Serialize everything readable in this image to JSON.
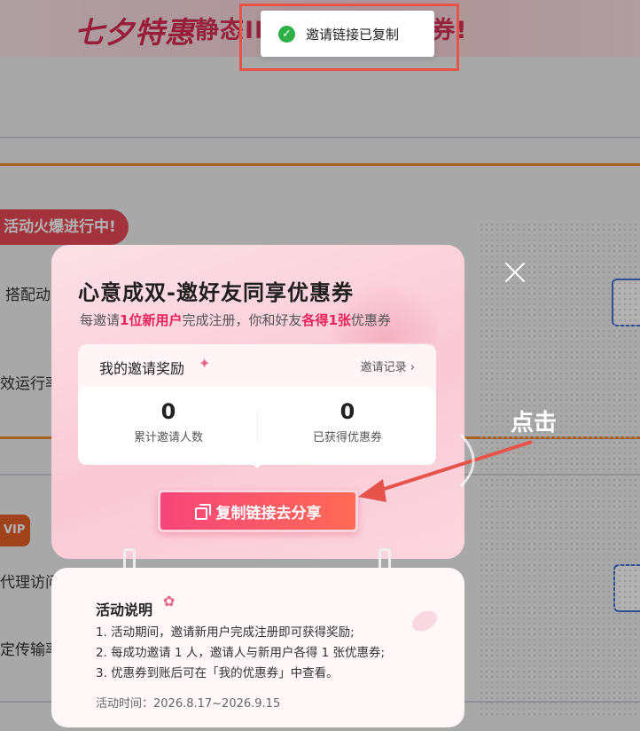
{
  "banner": {
    "logo": "七夕特惠",
    "slogan": "静态IP 好友互赠折扣券!"
  },
  "background": {
    "hot_tag": "活动火爆进行中!",
    "text_1": "搭配动",
    "text_2": "效运行率",
    "vip_tag": "VIP",
    "text_3": "代理访问",
    "text_4": "定传输率"
  },
  "toast": {
    "message": "邀请链接已复制"
  },
  "invite_card": {
    "title": "心意成双-邀好友同享优惠券",
    "subtitle_prefix": "每邀请",
    "subtitle_hl1": "1位新用户",
    "subtitle_mid": "完成注册，你和好友",
    "subtitle_hl2": "各得1张",
    "subtitle_suffix": "优惠券",
    "reward_title": "我的邀请奖励",
    "reward_link": "邀请记录 ›",
    "stats": [
      {
        "value": "0",
        "label": "累计邀请人数"
      },
      {
        "value": "0",
        "label": "已获得优惠券"
      }
    ],
    "share_button": "复制链接去分享"
  },
  "rules": {
    "title": "活动说明",
    "items": [
      "1. 活动期间，邀请新用户完成注册即可获得奖励;",
      "2. 每成功邀请 1 人，邀请人与新用户各得 1 张优惠券;",
      "3. 优惠券到账后可在「我的优惠券」中查看。"
    ],
    "time": "活动时间：2026.8.17~2026.9.15"
  },
  "annotation": {
    "label": "点击"
  },
  "icons": {
    "toast": "check-circle-icon",
    "close": "close-icon",
    "share": "copy-icon"
  },
  "colors": {
    "accent": "#f6457a",
    "highlight": "#e8245c",
    "success": "#2db146"
  }
}
